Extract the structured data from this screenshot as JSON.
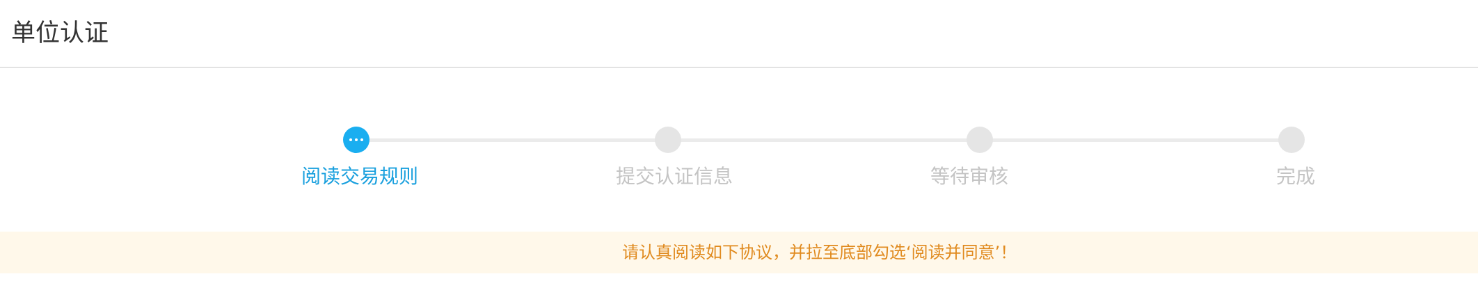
{
  "page": {
    "title": "单位认证"
  },
  "steps": [
    {
      "label": "阅读交易规则",
      "state": "active",
      "icon": "more-dots-icon"
    },
    {
      "label": "提交认证信息",
      "state": "pending"
    },
    {
      "label": "等待审核",
      "state": "pending"
    },
    {
      "label": "完成",
      "state": "pending"
    }
  ],
  "notice": {
    "text": "请认真阅读如下协议，并拉至底部勾选‘阅读并同意’！"
  },
  "colors": {
    "active": "#1aaef0",
    "pending": "#e5e5e5",
    "notice_bg": "#fff8ea",
    "notice_text": "#e08a1e"
  }
}
